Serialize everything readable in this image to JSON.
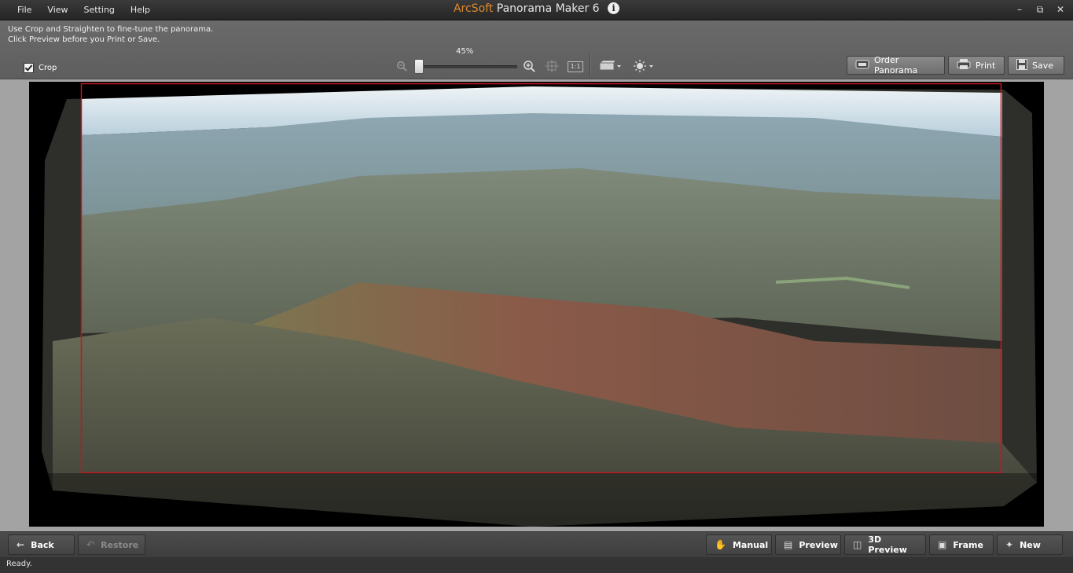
{
  "menu": {
    "file": "File",
    "view": "View",
    "setting": "Setting",
    "help": "Help"
  },
  "title": {
    "brand": "ArcSoft",
    "product": "Panorama Maker 6",
    "info_icon": "i"
  },
  "window_controls": {
    "minimize": "–",
    "restore": "⧉",
    "close": "✕"
  },
  "toolbar": {
    "hint_line1": "Use Crop and Straighten to fine-tune the panorama.",
    "hint_line2": "Click Preview before you Print or Save.",
    "crop_label": "Crop",
    "crop_checked": true,
    "zoom_level": "45%",
    "zoom_value": 0.02,
    "one_to_one": "1:1",
    "order_label": "Order Panorama",
    "print_label": "Print",
    "save_label": "Save"
  },
  "colors": {
    "brand": "#e08a2b",
    "crop_border": "#c2161e",
    "canvas_bg": "#a3a3a3"
  },
  "bottom": {
    "back": "Back",
    "restore": "Restore",
    "manual": "Manual",
    "preview": "Preview",
    "preview_3d": "3D Preview",
    "frame": "Frame",
    "new": "New"
  },
  "status": "Ready."
}
